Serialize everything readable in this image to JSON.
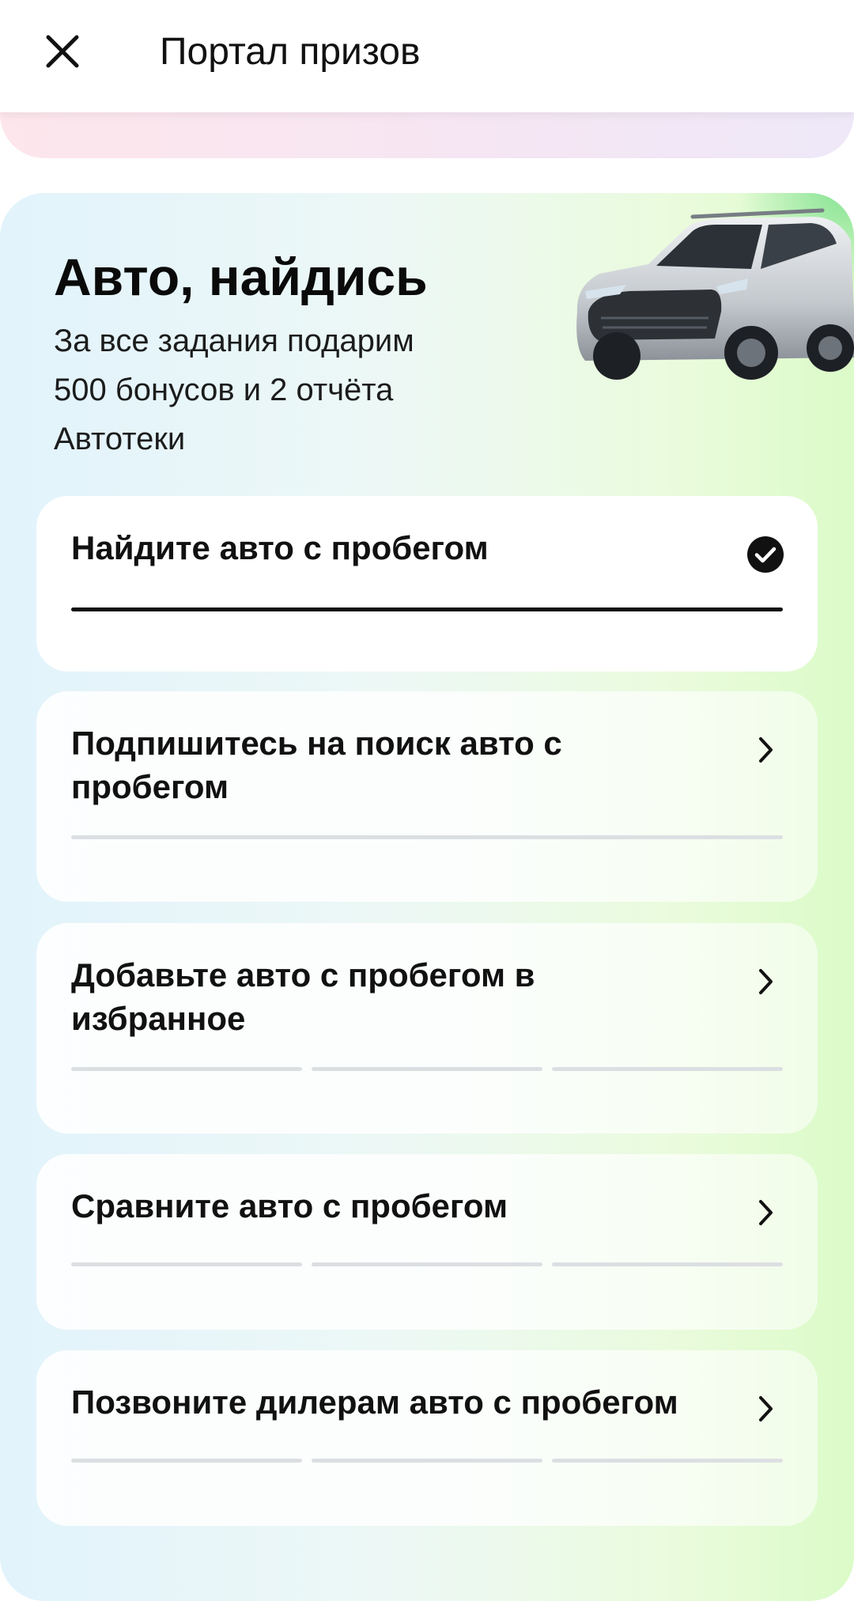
{
  "header": {
    "title": "Портал призов",
    "close_icon": "close-icon"
  },
  "promo": {
    "title": "Авто, найдись",
    "subtitle": "За все задания подарим 500 бонусов и 2 отчёта Автотеки",
    "image": "car-illustration",
    "colors": {
      "gradient_start": "#e2f3fc",
      "gradient_end": "#dbfbc8"
    }
  },
  "tasks": [
    {
      "label": "Найдите авто с пробегом",
      "status": "done",
      "icon": "check-circle-icon",
      "progress_completed": 1,
      "progress_total": 1
    },
    {
      "label": "Подпишитесь на поиск авто с пробегом",
      "status": "open",
      "icon": "chevron-right-icon",
      "progress_completed": 0,
      "progress_total": 1
    },
    {
      "label": "Добавьте авто с пробегом в избранное",
      "status": "open",
      "icon": "chevron-right-icon",
      "progress_completed": 0,
      "progress_total": 3
    },
    {
      "label": "Сравните авто с пробегом",
      "status": "open",
      "icon": "chevron-right-icon",
      "progress_completed": 0,
      "progress_total": 3
    },
    {
      "label": "Позвоните дилерам авто с пробегом",
      "status": "open",
      "icon": "chevron-right-icon",
      "progress_completed": 0,
      "progress_total": 3
    }
  ]
}
